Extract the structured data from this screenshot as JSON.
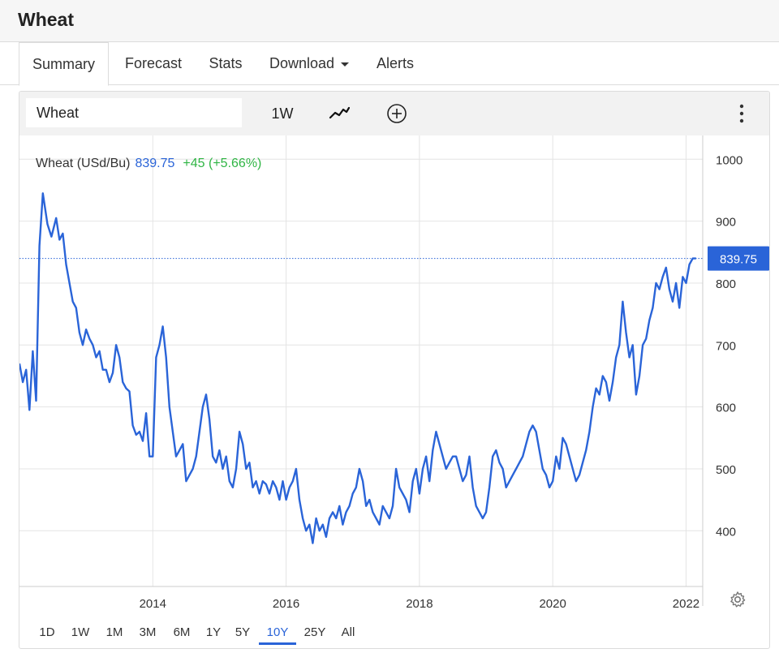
{
  "page": {
    "title": "Wheat"
  },
  "tabs": [
    {
      "label": "Summary",
      "active": true
    },
    {
      "label": "Forecast",
      "active": false
    },
    {
      "label": "Stats",
      "active": false
    },
    {
      "label": "Download",
      "active": false
    },
    {
      "label": "Alerts",
      "active": false
    }
  ],
  "toolbar": {
    "symbol_value": "Wheat",
    "interval_label": "1W",
    "chart_style_icon": "line-chart-icon",
    "compare_icon": "add-circle-icon",
    "menu_icon": "more-vertical-icon"
  },
  "legend": {
    "name": "Wheat (USd/Bu)",
    "price": "839.75",
    "change": "+45 (+5.66%)"
  },
  "price_tag": "839.75",
  "ranges": [
    {
      "label": "1D",
      "active": false
    },
    {
      "label": "1W",
      "active": false
    },
    {
      "label": "1M",
      "active": false
    },
    {
      "label": "3M",
      "active": false
    },
    {
      "label": "6M",
      "active": false
    },
    {
      "label": "1Y",
      "active": false
    },
    {
      "label": "5Y",
      "active": false
    },
    {
      "label": "10Y",
      "active": true
    },
    {
      "label": "25Y",
      "active": false
    },
    {
      "label": "All",
      "active": false
    }
  ],
  "settings_icon": "gear-icon",
  "colors": {
    "line": "#2a64d8",
    "positive": "#2fb544",
    "grid": "#e4e4e4"
  },
  "chart_data": {
    "type": "line",
    "title": "",
    "xlabel": "",
    "ylabel": "",
    "x_ticks": [
      "2014",
      "2016",
      "2018",
      "2020",
      "2022"
    ],
    "y_ticks": [
      400,
      500,
      600,
      700,
      800,
      900,
      1000
    ],
    "xlim": [
      2012.0,
      2022.25
    ],
    "ylim": [
      310,
      1020
    ],
    "last_value": 839.75,
    "series": [
      {
        "name": "Wheat (USd/Bu)",
        "x": [
          2012.0,
          2012.05,
          2012.1,
          2012.15,
          2012.2,
          2012.25,
          2012.3,
          2012.35,
          2012.42,
          2012.48,
          2012.55,
          2012.6,
          2012.65,
          2012.7,
          2012.75,
          2012.8,
          2012.85,
          2012.9,
          2012.95,
          2013.0,
          2013.05,
          2013.1,
          2013.15,
          2013.2,
          2013.25,
          2013.3,
          2013.35,
          2013.4,
          2013.45,
          2013.5,
          2013.55,
          2013.6,
          2013.65,
          2013.7,
          2013.75,
          2013.8,
          2013.85,
          2013.9,
          2013.95,
          2014.0,
          2014.05,
          2014.1,
          2014.15,
          2014.2,
          2014.25,
          2014.3,
          2014.35,
          2014.4,
          2014.45,
          2014.5,
          2014.55,
          2014.6,
          2014.65,
          2014.7,
          2014.75,
          2014.8,
          2014.85,
          2014.9,
          2014.95,
          2015.0,
          2015.05,
          2015.1,
          2015.15,
          2015.2,
          2015.25,
          2015.3,
          2015.35,
          2015.4,
          2015.45,
          2015.5,
          2015.55,
          2015.6,
          2015.65,
          2015.7,
          2015.75,
          2015.8,
          2015.85,
          2015.9,
          2015.95,
          2016.0,
          2016.05,
          2016.1,
          2016.15,
          2016.2,
          2016.25,
          2016.3,
          2016.35,
          2016.4,
          2016.45,
          2016.5,
          2016.55,
          2016.6,
          2016.65,
          2016.7,
          2016.75,
          2016.8,
          2016.85,
          2016.9,
          2016.95,
          2017.0,
          2017.05,
          2017.1,
          2017.15,
          2017.2,
          2017.25,
          2017.3,
          2017.35,
          2017.4,
          2017.45,
          2017.5,
          2017.55,
          2017.6,
          2017.65,
          2017.7,
          2017.75,
          2017.8,
          2017.85,
          2017.9,
          2017.95,
          2018.0,
          2018.05,
          2018.1,
          2018.15,
          2018.2,
          2018.25,
          2018.3,
          2018.35,
          2018.4,
          2018.45,
          2018.5,
          2018.55,
          2018.6,
          2018.65,
          2018.7,
          2018.75,
          2018.8,
          2018.85,
          2018.9,
          2018.95,
          2019.0,
          2019.05,
          2019.1,
          2019.15,
          2019.2,
          2019.25,
          2019.3,
          2019.35,
          2019.4,
          2019.45,
          2019.5,
          2019.55,
          2019.6,
          2019.65,
          2019.7,
          2019.75,
          2019.8,
          2019.85,
          2019.9,
          2019.95,
          2020.0,
          2020.05,
          2020.1,
          2020.15,
          2020.2,
          2020.25,
          2020.3,
          2020.35,
          2020.4,
          2020.45,
          2020.5,
          2020.55,
          2020.6,
          2020.65,
          2020.7,
          2020.75,
          2020.8,
          2020.85,
          2020.9,
          2020.95,
          2021.0,
          2021.05,
          2021.1,
          2021.15,
          2021.2,
          2021.25,
          2021.3,
          2021.35,
          2021.4,
          2021.45,
          2021.5,
          2021.55,
          2021.6,
          2021.65,
          2021.7,
          2021.75,
          2021.8,
          2021.85,
          2021.9,
          2021.95,
          2022.0,
          2022.05,
          2022.1,
          2022.15
        ],
        "values": [
          670,
          640,
          660,
          595,
          690,
          610,
          860,
          945,
          895,
          875,
          905,
          870,
          880,
          830,
          800,
          770,
          760,
          720,
          700,
          725,
          710,
          700,
          680,
          690,
          660,
          660,
          640,
          655,
          700,
          680,
          640,
          630,
          625,
          570,
          555,
          560,
          545,
          590,
          520,
          520,
          680,
          700,
          730,
          680,
          600,
          560,
          520,
          530,
          540,
          480,
          490,
          500,
          520,
          560,
          600,
          620,
          580,
          520,
          510,
          530,
          500,
          520,
          480,
          470,
          500,
          560,
          540,
          500,
          510,
          470,
          480,
          460,
          480,
          475,
          460,
          480,
          470,
          450,
          480,
          450,
          470,
          480,
          500,
          450,
          420,
          400,
          410,
          380,
          420,
          400,
          410,
          390,
          420,
          430,
          420,
          440,
          410,
          430,
          440,
          460,
          470,
          500,
          480,
          440,
          450,
          430,
          420,
          410,
          440,
          430,
          420,
          440,
          500,
          470,
          460,
          450,
          430,
          480,
          500,
          460,
          500,
          520,
          480,
          530,
          560,
          540,
          520,
          500,
          510,
          520,
          520,
          500,
          480,
          490,
          520,
          470,
          440,
          430,
          420,
          430,
          470,
          520,
          530,
          510,
          500,
          470,
          480,
          490,
          500,
          510,
          520,
          540,
          560,
          570,
          560,
          530,
          500,
          490,
          470,
          480,
          520,
          500,
          550,
          540,
          520,
          500,
          480,
          490,
          510,
          530,
          560,
          600,
          630,
          620,
          650,
          640,
          610,
          640,
          680,
          700,
          770,
          720,
          680,
          700,
          620,
          650,
          700,
          710,
          740,
          760,
          800,
          790,
          810,
          825,
          790,
          770,
          800,
          760,
          810,
          800,
          830,
          839.75,
          839.75
        ]
      }
    ]
  }
}
